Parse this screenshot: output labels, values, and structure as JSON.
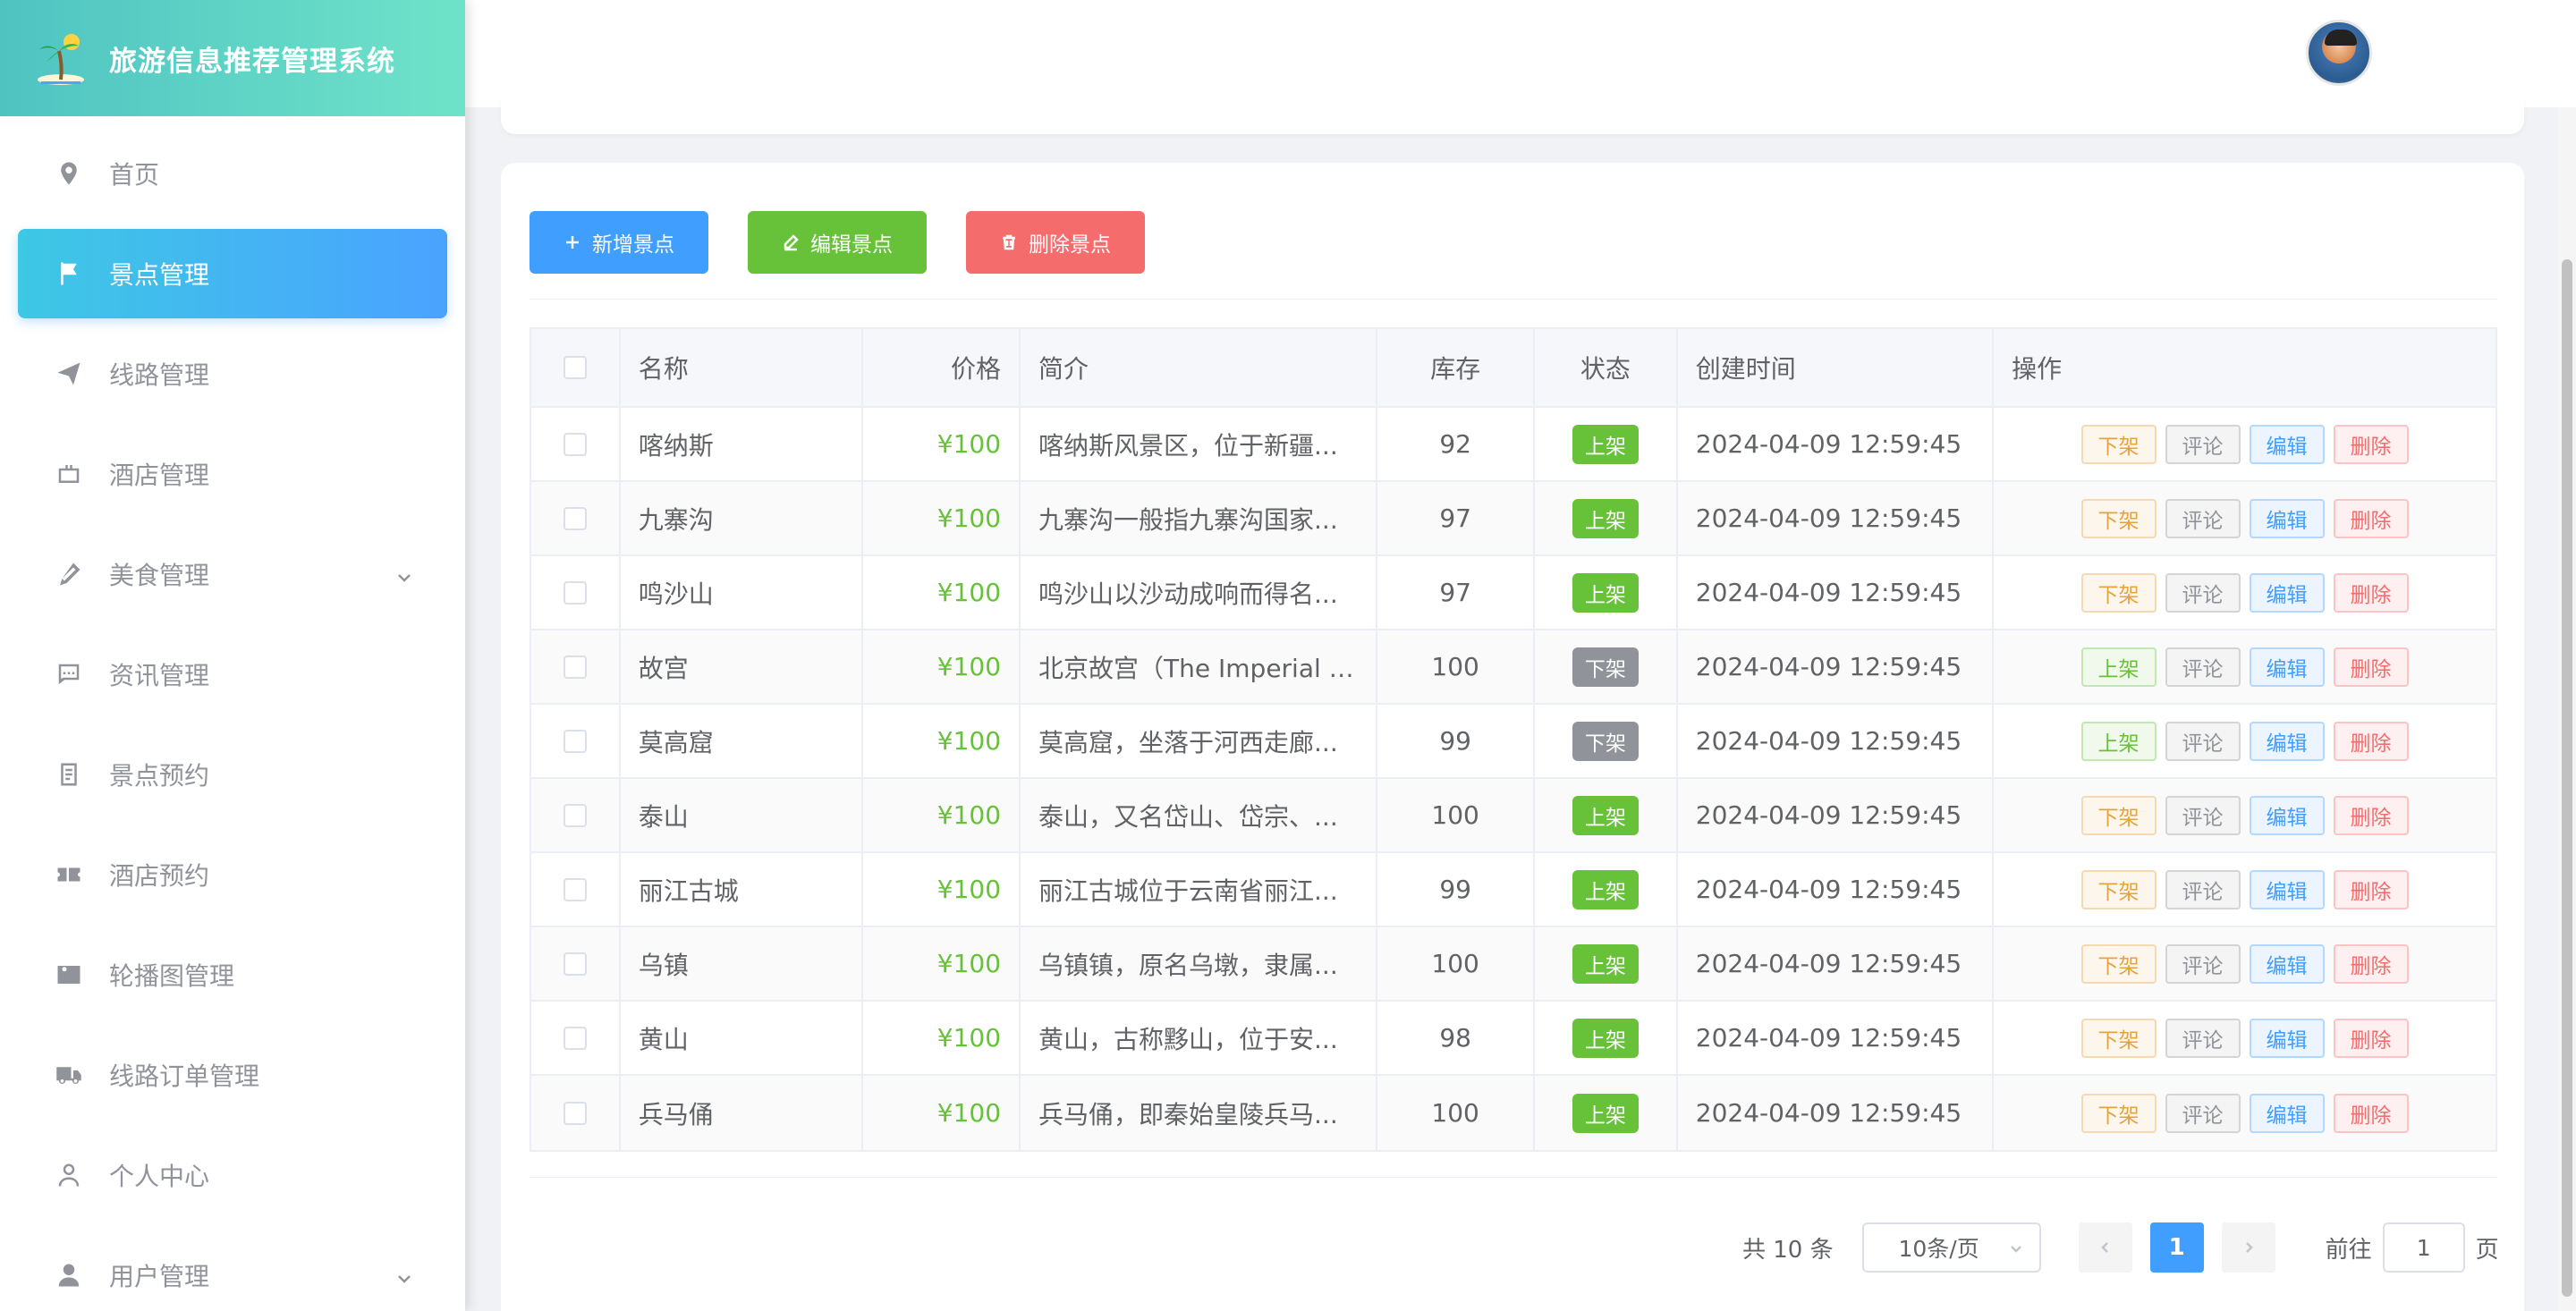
{
  "app": {
    "title": "旅游信息推荐管理系统"
  },
  "sidebar": {
    "items": [
      {
        "label": "首页",
        "icon": "location-icon",
        "active": false
      },
      {
        "label": "景点管理",
        "icon": "flag-icon",
        "active": true
      },
      {
        "label": "线路管理",
        "icon": "paper-plane-icon",
        "active": false
      },
      {
        "label": "酒店管理",
        "icon": "briefcase-icon",
        "active": false
      },
      {
        "label": "美食管理",
        "icon": "food-icon",
        "active": false,
        "expandable": true
      },
      {
        "label": "资讯管理",
        "icon": "chat-icon",
        "active": false
      },
      {
        "label": "景点预约",
        "icon": "document-icon",
        "active": false
      },
      {
        "label": "酒店预约",
        "icon": "ticket-icon",
        "active": false
      },
      {
        "label": "轮播图管理",
        "icon": "picture-icon",
        "active": false
      },
      {
        "label": "线路订单管理",
        "icon": "truck-icon",
        "active": false
      },
      {
        "label": "个人中心",
        "icon": "user-icon",
        "active": false
      },
      {
        "label": "用户管理",
        "icon": "user-filled-icon",
        "active": false,
        "expandable": true
      }
    ]
  },
  "toolbar": {
    "add_label": "新增景点",
    "edit_label": "编辑景点",
    "delete_label": "删除景点"
  },
  "table": {
    "headers": {
      "name": "名称",
      "price": "价格",
      "intro": "简介",
      "stock": "库存",
      "status": "状态",
      "created": "创建时间",
      "ops": "操作"
    },
    "rows": [
      {
        "name": "喀纳斯",
        "price": "¥100",
        "intro": "喀纳斯风景区，位于新疆...",
        "stock": "92",
        "status": "上架",
        "created": "2024-04-09 12:59:45",
        "toggle": "下架"
      },
      {
        "name": "九寨沟",
        "price": "¥100",
        "intro": "九寨沟一般指九寨沟国家...",
        "stock": "97",
        "status": "上架",
        "created": "2024-04-09 12:59:45",
        "toggle": "下架"
      },
      {
        "name": "鸣沙山",
        "price": "¥100",
        "intro": "鸣沙山以沙动成响而得名...",
        "stock": "97",
        "status": "上架",
        "created": "2024-04-09 12:59:45",
        "toggle": "下架"
      },
      {
        "name": "故宫",
        "price": "¥100",
        "intro": "北京故宫（The Imperial P...",
        "stock": "100",
        "status": "下架",
        "created": "2024-04-09 12:59:45",
        "toggle": "上架"
      },
      {
        "name": "莫高窟",
        "price": "¥100",
        "intro": "莫高窟，坐落于河西走廊...",
        "stock": "99",
        "status": "下架",
        "created": "2024-04-09 12:59:45",
        "toggle": "上架"
      },
      {
        "name": "泰山",
        "price": "¥100",
        "intro": "泰山，又名岱山、岱宗、...",
        "stock": "100",
        "status": "上架",
        "created": "2024-04-09 12:59:45",
        "toggle": "下架"
      },
      {
        "name": "丽江古城",
        "price": "¥100",
        "intro": "丽江古城位于云南省丽江...",
        "stock": "99",
        "status": "上架",
        "created": "2024-04-09 12:59:45",
        "toggle": "下架"
      },
      {
        "name": "乌镇",
        "price": "¥100",
        "intro": "乌镇镇，原名乌墩，隶属...",
        "stock": "100",
        "status": "上架",
        "created": "2024-04-09 12:59:45",
        "toggle": "下架"
      },
      {
        "name": "黄山",
        "price": "¥100",
        "intro": "黄山，古称黟山，位于安...",
        "stock": "98",
        "status": "上架",
        "created": "2024-04-09 12:59:45",
        "toggle": "下架"
      },
      {
        "name": "兵马俑",
        "price": "¥100",
        "intro": "兵马俑，即秦始皇陵兵马...",
        "stock": "100",
        "status": "上架",
        "created": "2024-04-09 12:59:45",
        "toggle": "下架"
      }
    ],
    "ops": {
      "comment": "评论",
      "edit": "编辑",
      "delete": "删除"
    }
  },
  "pagination": {
    "total": "共 10 条",
    "page_size": "10条/页",
    "current": "1",
    "goto_label": "前往",
    "goto_value": "1",
    "goto_unit": "页"
  },
  "colors": {
    "primary": "#409eff",
    "success": "#67c23a",
    "danger": "#f56c6c",
    "warning": "#e6a23c",
    "info": "#909399"
  }
}
